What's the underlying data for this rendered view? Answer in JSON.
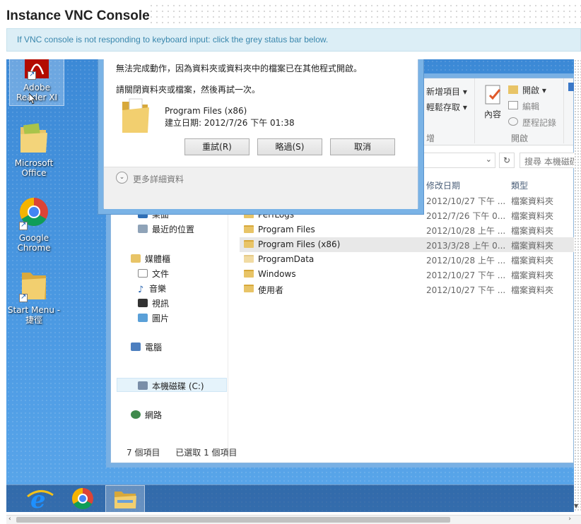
{
  "page": {
    "title": "Instance VNC Console",
    "info": "If VNC console is not responding to keyboard input: click the grey status bar below."
  },
  "desktop_icons": [
    {
      "label": "Adobe Reader XI",
      "icon": "adobe-reader-icon",
      "selected": true
    },
    {
      "label": "Microsoft Office",
      "icon": "folder-icon"
    },
    {
      "label": "Google Chrome",
      "icon": "chrome-icon"
    },
    {
      "label": "Start Menu - 捷徑",
      "icon": "folder-icon"
    }
  ],
  "explorer": {
    "ribbon": {
      "new_item": "新增項目 ▾",
      "easy_access": "輕鬆存取 ▾",
      "group_new": "增",
      "properties": "內容",
      "open": "開啟 ▾",
      "edit": "編輯",
      "history": "歷程記錄",
      "group_open": "開啟"
    },
    "search_placeholder": "搜尋 本機磁碟",
    "columns": {
      "date": "修改日期",
      "type": "類型"
    },
    "nav": {
      "desktop": "桌面",
      "recent": "最近的位置",
      "libraries": "媒體櫃",
      "documents": "文件",
      "music": "音樂",
      "videos": "視訊",
      "pictures": "圖片",
      "computer": "電腦",
      "local_disk": "本機磁碟 (C:)",
      "network": "網路"
    },
    "files": [
      {
        "name": "",
        "date": "2012/10/27 下午 ...",
        "type": "檔案資料夾"
      },
      {
        "name": "PerfLogs",
        "date": "2012/7/26 下午 0...",
        "type": "檔案資料夾"
      },
      {
        "name": "Program Files",
        "date": "2012/10/28 上午 ...",
        "type": "檔案資料夾"
      },
      {
        "name": "Program Files (x86)",
        "date": "2013/3/28 上午 0...",
        "type": "檔案資料夾",
        "selected": true
      },
      {
        "name": "ProgramData",
        "date": "2012/10/28 上午 ...",
        "type": "檔案資料夾"
      },
      {
        "name": "Windows",
        "date": "2012/10/27 下午 ...",
        "type": "檔案資料夾"
      },
      {
        "name": "使用者",
        "date": "2012/10/27 下午 ...",
        "type": "檔案資料夾"
      }
    ],
    "status": {
      "count": "7 個項目",
      "selected": "已選取 1 個項目"
    }
  },
  "dialog": {
    "message": "無法完成動作，因為資料夾或資料夾中的檔案已在其他程式開啟。",
    "instruction": "請關閉資料夾或檔案，然後再試一次。",
    "item_name": "Program Files (x86)",
    "item_created": "建立日期: 2012/7/26 下午 01:38",
    "retry": "重試(R)",
    "skip": "略過(S)",
    "cancel": "取消",
    "more_details": "更多詳細資料"
  },
  "taskbar": {
    "items": [
      "internet-explorer-icon",
      "chrome-icon",
      "file-explorer-icon"
    ],
    "active": "file-explorer-icon"
  },
  "colors": {
    "info_bg": "#dceef6",
    "info_text": "#3a87ad",
    "desktop_blue": "#3f8fd8"
  }
}
